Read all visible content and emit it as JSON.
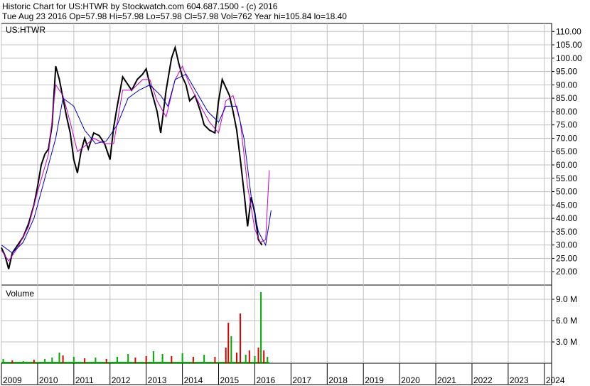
{
  "header": {
    "line1": "Historic Chart for US:HTWR by Stockwatch.com 604.687.1500 - (c) 2016",
    "line2": "Tue Aug 23 2016  Op=57.98  Hi=57.98  Lo=57.98  Cl=57.98  Vol=762  Year hi=105.84  lo=18.40"
  },
  "colors": {
    "price": "#000000",
    "ma_short": "#cc00cc",
    "ma_long": "#0000cc",
    "volume_up": "#00aa00",
    "volume_down": "#dd0000",
    "grid": "#c0c0c0"
  },
  "chart_data": [
    {
      "type": "line",
      "panel_label": "US:HTWR",
      "ylim": [
        15,
        113
      ],
      "yticks": [
        "110.00",
        "105.00",
        "100.00",
        "95.00",
        "90.00",
        "85.00",
        "80.00",
        "75.00",
        "70.00",
        "65.00",
        "60.00",
        "55.00",
        "50.00",
        "45.00",
        "40.00",
        "35.00",
        "30.00",
        "25.00",
        "20.00"
      ],
      "ytick_values": [
        110,
        105,
        100,
        95,
        90,
        85,
        80,
        75,
        70,
        65,
        60,
        55,
        50,
        45,
        40,
        35,
        30,
        25,
        20
      ],
      "x_labels": [
        "2009",
        "2010",
        "2011",
        "2012",
        "2013",
        "2014",
        "2015",
        "2016",
        "2017",
        "2018",
        "2019",
        "2020",
        "2021",
        "2022",
        "2023",
        "2024"
      ],
      "x_years": [
        2009,
        2010,
        2011,
        2012,
        2013,
        2014,
        2015,
        2016,
        2017,
        2018,
        2019,
        2020,
        2021,
        2022,
        2023,
        2024
      ],
      "xlim": [
        2009.0,
        2024.2
      ],
      "grid": true,
      "series": [
        {
          "role": "price",
          "x": [
            2009.0,
            2009.1,
            2009.2,
            2009.3,
            2009.45,
            2009.6,
            2009.75,
            2009.9,
            2010.0,
            2010.1,
            2010.2,
            2010.3,
            2010.4,
            2010.5,
            2010.6,
            2010.7,
            2010.8,
            2010.9,
            2011.0,
            2011.1,
            2011.2,
            2011.3,
            2011.4,
            2011.55,
            2011.7,
            2011.85,
            2012.0,
            2012.1,
            2012.2,
            2012.35,
            2012.5,
            2012.6,
            2012.75,
            2012.9,
            2013.0,
            2013.1,
            2013.2,
            2013.3,
            2013.4,
            2013.55,
            2013.7,
            2013.8,
            2013.9,
            2014.0,
            2014.1,
            2014.2,
            2014.35,
            2014.5,
            2014.6,
            2014.75,
            2014.9,
            2015.0,
            2015.1,
            2015.2,
            2015.3,
            2015.4,
            2015.5,
            2015.6,
            2015.7,
            2015.8,
            2015.9,
            2016.0,
            2016.1,
            2016.2
          ],
          "y": [
            29,
            26,
            21,
            27,
            30,
            33,
            38,
            45,
            52,
            60,
            64,
            66,
            75,
            97,
            92,
            85,
            78,
            72,
            62,
            57,
            65,
            70,
            66,
            72,
            71,
            68,
            62,
            74,
            82,
            93,
            90,
            88,
            92,
            94,
            96,
            90,
            85,
            80,
            72,
            88,
            100,
            104,
            98,
            93,
            90,
            84,
            86,
            80,
            75,
            73,
            72,
            84,
            92,
            89,
            86,
            80,
            73,
            62,
            50,
            37,
            48,
            42,
            32,
            30
          ]
        },
        {
          "role": "ma_short",
          "x": [
            2009.0,
            2009.2,
            2009.45,
            2009.75,
            2010.0,
            2010.3,
            2010.5,
            2010.7,
            2010.9,
            2011.1,
            2011.3,
            2011.55,
            2011.85,
            2012.1,
            2012.35,
            2012.6,
            2012.9,
            2013.1,
            2013.3,
            2013.55,
            2013.8,
            2014.0,
            2014.2,
            2014.5,
            2014.75,
            2015.0,
            2015.2,
            2015.4,
            2015.6,
            2015.8,
            2016.0,
            2016.15,
            2016.3,
            2016.4
          ],
          "y": [
            28,
            24,
            29,
            37,
            50,
            64,
            90,
            86,
            76,
            65,
            67,
            70,
            68,
            68,
            88,
            88,
            92,
            92,
            84,
            78,
            92,
            97,
            90,
            82,
            76,
            72,
            84,
            86,
            76,
            52,
            36,
            31,
            32,
            58
          ]
        },
        {
          "role": "ma_long",
          "x": [
            2009.0,
            2009.3,
            2009.6,
            2009.9,
            2010.2,
            2010.5,
            2010.7,
            2011.0,
            2011.3,
            2011.6,
            2011.9,
            2012.2,
            2012.5,
            2012.8,
            2013.1,
            2013.4,
            2013.6,
            2013.8,
            2014.1,
            2014.4,
            2014.7,
            2015.0,
            2015.2,
            2015.5,
            2015.7,
            2015.9,
            2016.1,
            2016.3,
            2016.45
          ],
          "y": [
            30,
            27,
            31,
            40,
            55,
            70,
            85,
            82,
            73,
            68,
            69,
            75,
            85,
            88,
            90,
            86,
            82,
            92,
            94,
            87,
            80,
            76,
            82,
            82,
            70,
            48,
            35,
            30,
            43
          ]
        }
      ]
    },
    {
      "type": "bar",
      "panel_label": "Volume",
      "ylim": [
        0,
        11
      ],
      "yticks": [
        "9.0 M",
        "6.0 M",
        "3.0 M"
      ],
      "ytick_values": [
        9,
        6,
        3
      ],
      "y_units": "M",
      "bars": [
        {
          "x": 2009.05,
          "v": 0.6,
          "up": true
        },
        {
          "x": 2009.3,
          "v": 0.4,
          "up": false
        },
        {
          "x": 2009.6,
          "v": 0.3,
          "up": true
        },
        {
          "x": 2009.9,
          "v": 0.5,
          "up": false
        },
        {
          "x": 2010.2,
          "v": 0.6,
          "up": true
        },
        {
          "x": 2010.4,
          "v": 0.8,
          "up": true
        },
        {
          "x": 2010.6,
          "v": 1.5,
          "up": true
        },
        {
          "x": 2010.7,
          "v": 1.1,
          "up": false
        },
        {
          "x": 2011.0,
          "v": 0.9,
          "up": true
        },
        {
          "x": 2011.3,
          "v": 0.7,
          "up": false
        },
        {
          "x": 2011.6,
          "v": 0.8,
          "up": true
        },
        {
          "x": 2011.9,
          "v": 0.6,
          "up": false
        },
        {
          "x": 2012.2,
          "v": 0.9,
          "up": true
        },
        {
          "x": 2012.5,
          "v": 1.3,
          "up": true
        },
        {
          "x": 2012.7,
          "v": 0.8,
          "up": false
        },
        {
          "x": 2013.0,
          "v": 1.0,
          "up": false
        },
        {
          "x": 2013.2,
          "v": 1.7,
          "up": true
        },
        {
          "x": 2013.45,
          "v": 1.3,
          "up": true
        },
        {
          "x": 2013.7,
          "v": 1.0,
          "up": false
        },
        {
          "x": 2014.0,
          "v": 1.4,
          "up": true
        },
        {
          "x": 2014.3,
          "v": 0.9,
          "up": false
        },
        {
          "x": 2014.6,
          "v": 1.2,
          "up": true
        },
        {
          "x": 2014.9,
          "v": 0.9,
          "up": false
        },
        {
          "x": 2015.2,
          "v": 2.2,
          "up": false
        },
        {
          "x": 2015.27,
          "v": 5.7,
          "up": false
        },
        {
          "x": 2015.35,
          "v": 3.8,
          "up": true
        },
        {
          "x": 2015.5,
          "v": 1.5,
          "up": false
        },
        {
          "x": 2015.6,
          "v": 7.0,
          "up": false
        },
        {
          "x": 2015.75,
          "v": 1.2,
          "up": true
        },
        {
          "x": 2015.85,
          "v": 1.8,
          "up": false
        },
        {
          "x": 2016.0,
          "v": 1.0,
          "up": true
        },
        {
          "x": 2016.1,
          "v": 2.2,
          "up": false
        },
        {
          "x": 2016.17,
          "v": 10.0,
          "up": true
        },
        {
          "x": 2016.25,
          "v": 1.8,
          "up": false
        },
        {
          "x": 2016.35,
          "v": 0.9,
          "up": true
        }
      ]
    }
  ]
}
